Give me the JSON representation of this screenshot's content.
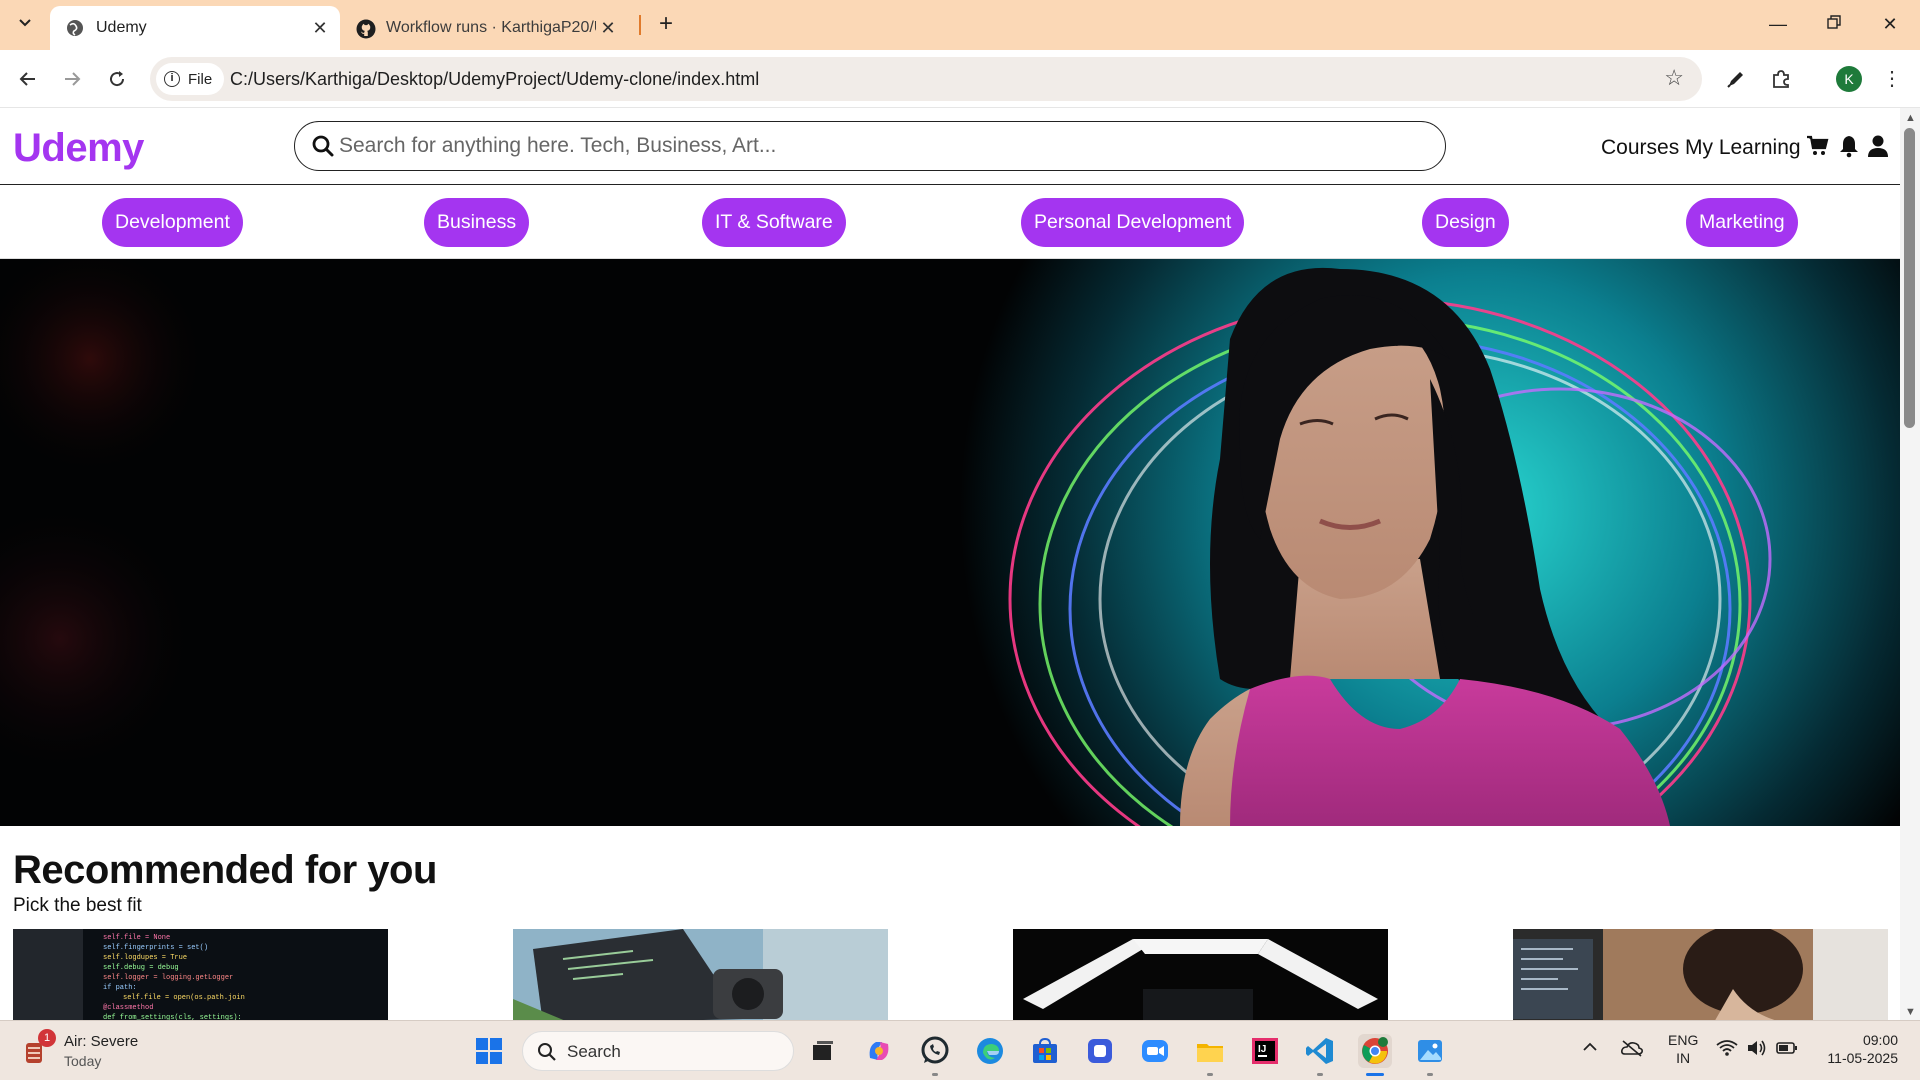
{
  "browser": {
    "tabs": [
      {
        "title": "Udemy",
        "active": true,
        "icon": "globe-icon"
      },
      {
        "title": "Workflow runs · KarthigaP20/Ud",
        "active": false,
        "icon": "github-icon"
      }
    ],
    "address": {
      "chip_label": "File",
      "url": "C:/Users/Karthiga/Desktop/UdemyProject/Udemy-clone/index.html"
    },
    "profile_initial": "K"
  },
  "page": {
    "logo": "Udemy",
    "search_placeholder": "Search for anything here. Tech, Business, Art...",
    "nav": {
      "courses": "Courses",
      "my_learning": "My Learning"
    },
    "categories": [
      "Development",
      "Business",
      "IT & Software",
      "Personal Development",
      "Design",
      "Marketing"
    ],
    "recommended": {
      "title": "Recommended for you",
      "subtitle": "Pick the best fit"
    }
  },
  "taskbar": {
    "weather": {
      "badge": "1",
      "title": "Air: Severe",
      "subtitle": "Today"
    },
    "search_label": "Search",
    "language": {
      "line1": "ENG",
      "line2": "IN"
    },
    "clock": {
      "time": "09:00",
      "date": "11-05-2025"
    }
  },
  "colors": {
    "brand": "#a435f0",
    "tabstrip": "#fbd8b6",
    "taskbar": "#efe6df"
  }
}
